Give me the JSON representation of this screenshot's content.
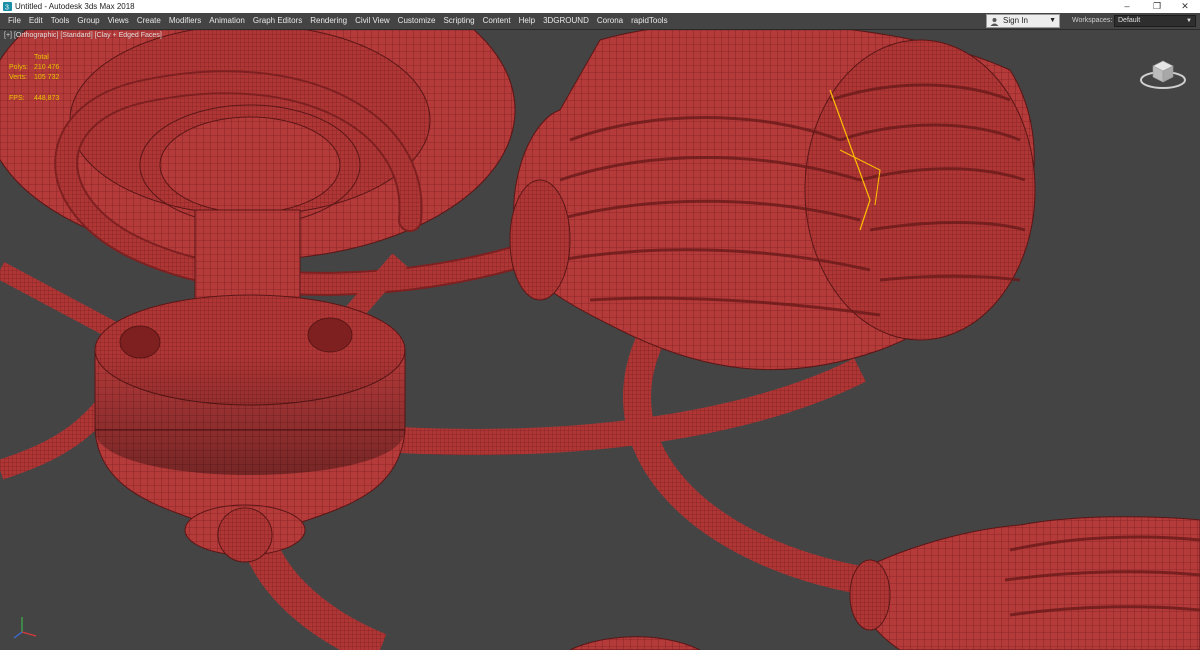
{
  "titlebar": {
    "title": "Untitled - Autodesk 3ds Max 2018",
    "minimize": "–",
    "maximize": "❐",
    "close": "✕"
  },
  "menubar": {
    "items": [
      "File",
      "Edit",
      "Tools",
      "Group",
      "Views",
      "Create",
      "Modifiers",
      "Animation",
      "Graph Editors",
      "Rendering",
      "Civil View",
      "Customize",
      "Scripting",
      "Content",
      "Help",
      "3DGROUND",
      "Corona",
      "rapidTools"
    ],
    "signin": "Sign In",
    "workspaces_label": "Workspaces:",
    "workspace_value": "Default"
  },
  "viewport": {
    "label_plus": "[+]",
    "label_view": "[Orthographic]",
    "label_shading": "[Standard]",
    "label_mode": "[Clay + Edged Faces]",
    "stats": {
      "total_label": "Total",
      "polys_label": "Polys:",
      "polys_value": "210 476",
      "verts_label": "Verts:",
      "verts_value": "105 732",
      "fps_label": "FPS:",
      "fps_value": "448,873"
    }
  },
  "colors": {
    "clay": "#b53a3a",
    "clay_dark": "#7e2020",
    "viewport_bg": "#444444",
    "stats_text": "#e8c400",
    "selection": "#ffc000"
  },
  "icons": {
    "app": "3dsmax-icon",
    "signin": "user-icon",
    "viewcube": "viewcube-icon",
    "axis": "axis-tripod-icon"
  }
}
